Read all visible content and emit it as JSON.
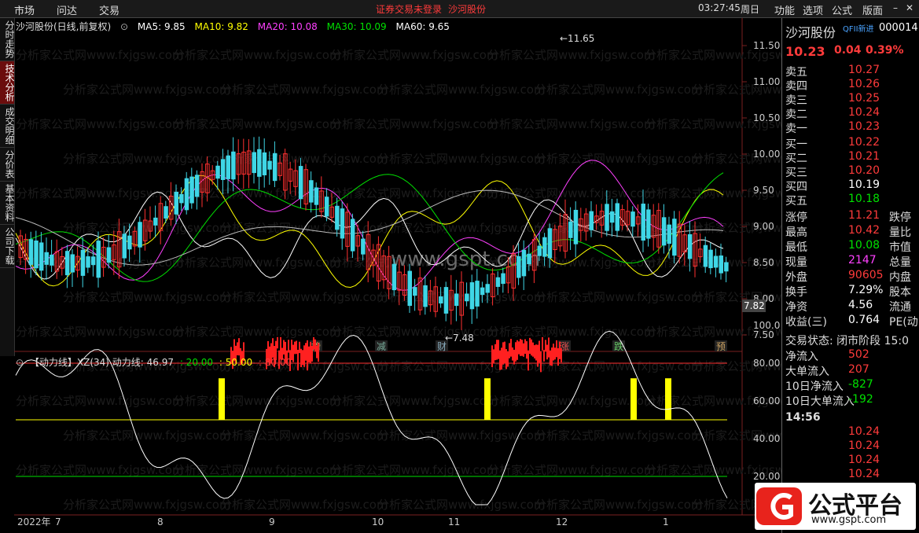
{
  "menu": {
    "market": "市场",
    "wenda": "问达",
    "trade": "交易",
    "notice": "证券交易未登录",
    "stock_name": "沙河股份",
    "time": "03:27:45",
    "weekday": "周日",
    "func": "功能",
    "options": "选项",
    "formula": "公式",
    "layout": "版面"
  },
  "side_tabs": [
    "分时走势",
    "技术分析",
    "成交明细",
    "分价表",
    "基本资料",
    "公司下载"
  ],
  "chart": {
    "title": "沙河股份(日线,前复权)",
    "ma": [
      {
        "label": "MA5: 9.85",
        "color": "#ffffff"
      },
      {
        "label": "MA10: 9.82",
        "color": "#ffff00"
      },
      {
        "label": "MA20: 10.08",
        "color": "#ff40ff"
      },
      {
        "label": "MA30: 10.09",
        "color": "#00e000"
      },
      {
        "label": "MA60: 9.65",
        "color": "#ffffff"
      }
    ],
    "y_ticks": [
      "11.50",
      "11.00",
      "10.50",
      "10.00",
      "9.50",
      "9.00",
      "8.50",
      "8.00",
      "7.50"
    ],
    "high_label": "11.65",
    "low_label": "7.48",
    "current_label": "7.82",
    "event_labels": [
      {
        "t": "榜"
      },
      {
        "t": "减"
      },
      {
        "t": "财"
      },
      {
        "t": "涨"
      },
      {
        "t": "跌"
      },
      {
        "t": "预"
      }
    ],
    "watermark": "www.gspt.com",
    "watermark_text": "分析家公式网www.fxjgsw.com"
  },
  "indicator": {
    "title": "【动力线】XZ(34) 动力线: 46.97",
    "l20": ": 20.00",
    "l50": ": 50.00",
    "l80": ": 80.00",
    "y_ticks": [
      "100.0",
      "80.00",
      "60.00",
      "40.00",
      "20.00"
    ]
  },
  "x_axis": [
    "2022年",
    "7",
    "8",
    "9",
    "10",
    "11",
    "12",
    "1"
  ],
  "quote": {
    "name": "沙河股份",
    "tag": "QFII新进",
    "code": "000014",
    "price": "10.23",
    "change": "0.04",
    "pct": "0.39%",
    "sells": [
      {
        "l": "卖五",
        "v": "10.27"
      },
      {
        "l": "卖四",
        "v": "10.26"
      },
      {
        "l": "卖三",
        "v": "10.25"
      },
      {
        "l": "卖二",
        "v": "10.24"
      },
      {
        "l": "卖一",
        "v": "10.23"
      }
    ],
    "buys": [
      {
        "l": "买一",
        "v": "10.22"
      },
      {
        "l": "买二",
        "v": "10.21"
      },
      {
        "l": "买三",
        "v": "10.20"
      },
      {
        "l": "买四",
        "v": "10.19"
      },
      {
        "l": "买五",
        "v": "10.18"
      }
    ],
    "stats": [
      {
        "l": "涨停",
        "v": "11.21",
        "l2": "跌停"
      },
      {
        "l": "最高",
        "v": "10.42",
        "l2": "量比"
      },
      {
        "l": "最低",
        "v": "10.08",
        "l2": "市值"
      },
      {
        "l": "现量",
        "v": "2147",
        "l2": "总量"
      },
      {
        "l": "外盘",
        "v": "90605",
        "l2": "内盘"
      }
    ],
    "fund": [
      {
        "l": "换手",
        "v": "7.29%",
        "l2": "股本"
      },
      {
        "l": "净资",
        "v": "4.56",
        "l2": "流通"
      },
      {
        "l": "收益(三)",
        "v": "0.764",
        "l2": "PE(动)"
      }
    ],
    "status": "交易状态: 闭市阶段 15:0",
    "flows": [
      {
        "l": "净流入",
        "v": "502"
      },
      {
        "l": "大单流入",
        "v": "207"
      },
      {
        "l": "10日净流入",
        "v": "-827"
      },
      {
        "l": "10日大单流入",
        "v": "-192"
      }
    ],
    "tick_time": "14:56",
    "ticks": [
      "10.24",
      "10.24",
      "10.24",
      "10.24",
      "10.24"
    ]
  },
  "logo": {
    "text": "公式平台",
    "url": "www.gspt.com"
  }
}
